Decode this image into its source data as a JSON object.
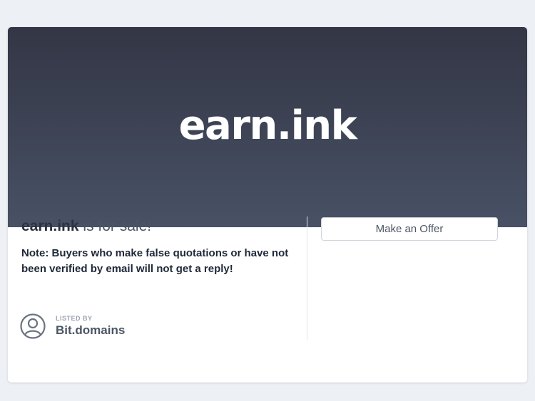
{
  "hero": {
    "domain_name": "earn.ink"
  },
  "sale": {
    "domain_name": "earn.ink",
    "suffix": " is for sale!",
    "note": "Note: Buyers who make false quotations or have not been verified by email will not get a reply!"
  },
  "offer": {
    "button_label": "Make an Offer"
  },
  "listed_by": {
    "label": "LISTED BY",
    "name": "Bit.domains",
    "icon": "user-circle-icon"
  },
  "colors": {
    "page_background": "#edf0f4",
    "hero_gradient_top": "#333645",
    "hero_gradient_bottom": "#485165",
    "text_dark": "#2d3340",
    "text_muted": "#4b5563"
  }
}
